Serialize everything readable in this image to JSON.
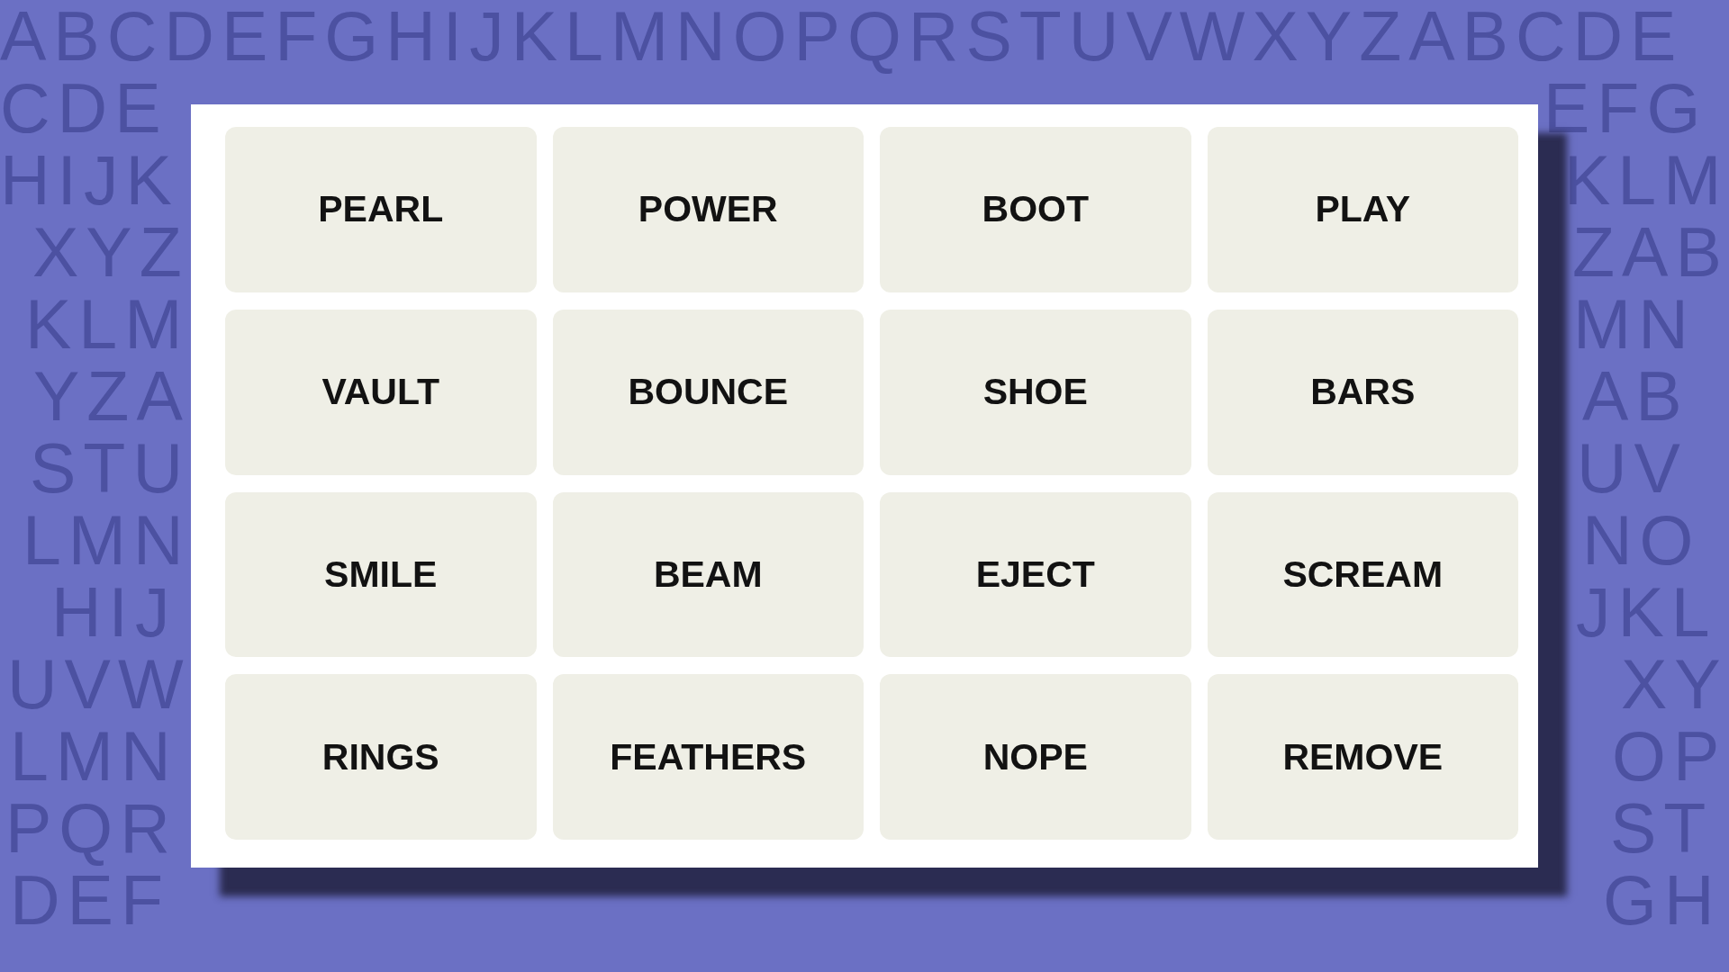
{
  "background": {
    "rows": [
      {
        "segments": [
          "ABCDEFGHIJKLMNOPQRSTUVWXYZABCDE"
        ]
      },
      {
        "segments": [
          "CDE",
          "EFG"
        ]
      },
      {
        "segments": [
          "HIJK",
          "KLM"
        ]
      },
      {
        "segments": [
          "XYZ",
          "ZAB"
        ]
      },
      {
        "segments": [
          "KLM",
          "MN"
        ]
      },
      {
        "segments": [
          "YZA",
          "AB"
        ]
      },
      {
        "segments": [
          "STU",
          "UV"
        ]
      },
      {
        "segments": [
          "LMN",
          "NO"
        ]
      },
      {
        "segments": [
          "HIJ",
          "JKL"
        ]
      },
      {
        "segments": [
          "UVW",
          "XY"
        ]
      },
      {
        "segments": [
          "LMN",
          "OP"
        ]
      },
      {
        "segments": [
          "PQR",
          "ST"
        ]
      },
      {
        "segments": [
          "DEF",
          "GH"
        ]
      }
    ]
  },
  "board": {
    "tiles": [
      {
        "word": "PEARL"
      },
      {
        "word": "POWER"
      },
      {
        "word": "BOOT"
      },
      {
        "word": "PLAY"
      },
      {
        "word": "VAULT"
      },
      {
        "word": "BOUNCE"
      },
      {
        "word": "SHOE"
      },
      {
        "word": "BARS"
      },
      {
        "word": "SMILE"
      },
      {
        "word": "BEAM"
      },
      {
        "word": "EJECT"
      },
      {
        "word": "SCREAM"
      },
      {
        "word": "RINGS"
      },
      {
        "word": "FEATHERS"
      },
      {
        "word": "NOPE"
      },
      {
        "word": "REMOVE"
      }
    ]
  }
}
